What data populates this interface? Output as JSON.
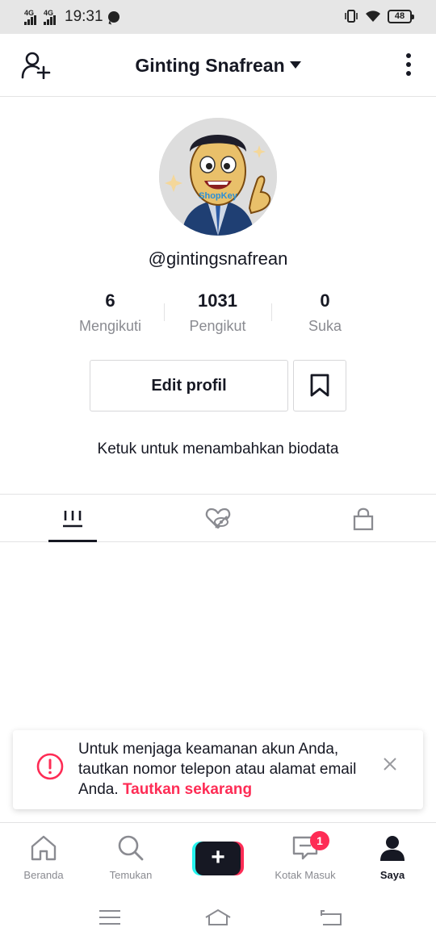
{
  "status_bar": {
    "signal1": "4G",
    "signal2": "4G",
    "time": "19:31",
    "battery": "48"
  },
  "header": {
    "title": "Ginting Snafrean"
  },
  "profile": {
    "avatar_text": "ShopKey",
    "username": "@gintingsnafrean",
    "stats": [
      {
        "value": "6",
        "label": "Mengikuti"
      },
      {
        "value": "1031",
        "label": "Pengikut"
      },
      {
        "value": "0",
        "label": "Suka"
      }
    ],
    "edit_label": "Edit profil",
    "bio_placeholder": "Ketuk untuk menambahkan biodata"
  },
  "tabs": [
    {
      "icon": "grid-videos-icon",
      "active": true
    },
    {
      "icon": "liked-hidden-icon",
      "active": false
    },
    {
      "icon": "lock-icon",
      "active": false
    }
  ],
  "toast": {
    "message": "Untuk menjaga keamanan akun Anda, tautkan nomor telepon atau alamat email Anda.",
    "link": "Tautkan sekarang"
  },
  "bottom_nav": {
    "items": [
      {
        "label": "Beranda",
        "icon": "home-icon"
      },
      {
        "label": "Temukan",
        "icon": "search-icon"
      },
      {
        "label": "",
        "icon": "create-plus-icon"
      },
      {
        "label": "Kotak Masuk",
        "icon": "inbox-icon"
      },
      {
        "label": "Saya",
        "icon": "profile-icon"
      }
    ],
    "inbox_badge": "1"
  },
  "colors": {
    "accent": "#fe2c55",
    "cyan": "#25f4ee",
    "text": "#161823",
    "muted": "#8a8b91"
  }
}
